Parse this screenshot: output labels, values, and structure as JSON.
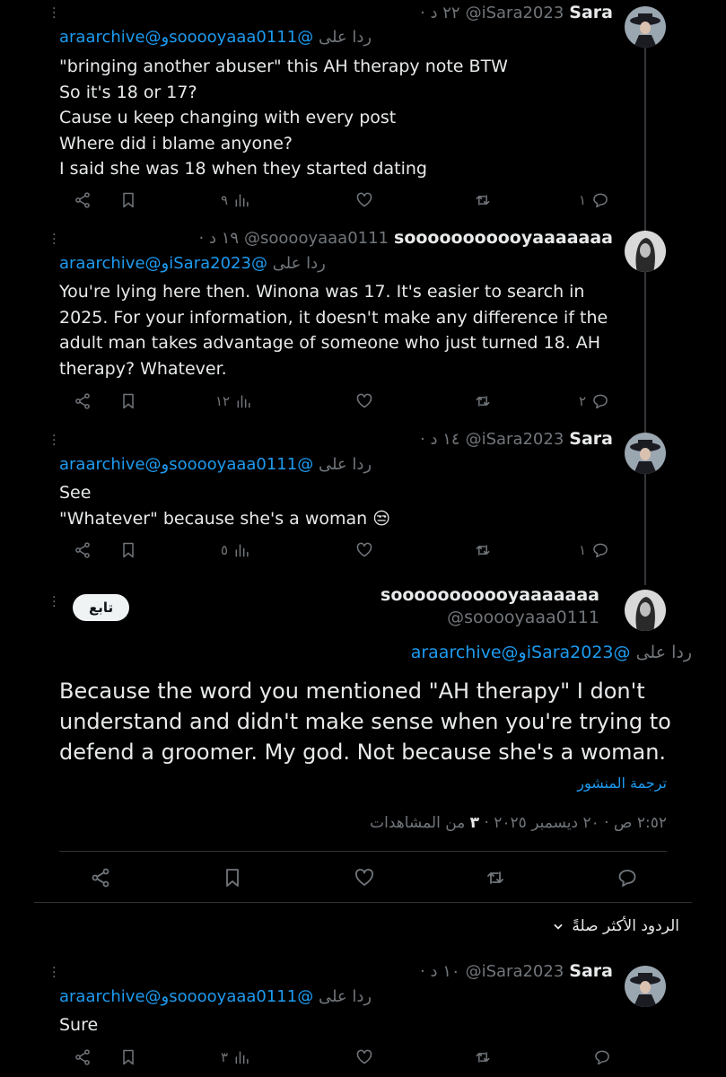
{
  "posts": [
    {
      "author_name": "Sara",
      "handle": "@iSara2023",
      "time": "· ٢٢ د",
      "reply_prefix": "ردا على",
      "reply_to_1": "@sooooyaaa0111",
      "reply_and": "و",
      "reply_to_2": "@araarchive",
      "lines": [
        "\"bringing another abuser\" this AH therapy note BTW",
        "So it's 18 or 17?",
        "Cause u keep changing with every post",
        "Where did i blame anyone?",
        "I said she was 18 when they started dating"
      ],
      "replies": "١",
      "views": "٩"
    },
    {
      "author_name": "sooooooooooyaaaaaaa",
      "handle": "@sooooyaaa0111",
      "time": "· ١٩ د",
      "reply_prefix": "ردا على",
      "reply_to_1": "@iSara2023",
      "reply_and": "و",
      "reply_to_2": "@araarchive",
      "lines": [
        "You're lying here then. Winona was 17. It's easier to search in",
        "2025. For your information, it doesn't make any difference if the",
        "adult man takes advantage of someone who just turned 18. AH",
        "therapy? Whatever."
      ],
      "replies": "٢",
      "views": "١٢"
    },
    {
      "author_name": "Sara",
      "handle": "@iSara2023",
      "time": "· ١٤ د",
      "reply_prefix": "ردا على",
      "reply_to_1": "@sooooyaaa0111",
      "reply_and": "و",
      "reply_to_2": "@araarchive",
      "lines": [
        "See",
        "\"Whatever\" because she's a woman 😒"
      ],
      "replies": "١",
      "views": "٥"
    }
  ],
  "main": {
    "author_name": "sooooooooooyaaaaaaa",
    "handle": "@sooooyaaa0111",
    "follow_label": "تابع",
    "reply_prefix": "ردا على",
    "reply_to_1": "@iSara2023",
    "reply_and": "و",
    "reply_to_2": "@araarchive",
    "lines": [
      "Because the word you mentioned \"AH therapy\" I don't",
      "understand and didn't make sense when you're trying to",
      "defend a groomer. My god. Not because she's a woman."
    ],
    "translate": "ترجمة المنشور",
    "timestamp": "٢:٥٢ ص · ٢٠ ديسمبر ٢٠٢٥ ·",
    "views_count": "٣",
    "views_label": "من المشاهدات"
  },
  "sort": {
    "label": "الردود الأكثر صلةً"
  },
  "last_post": {
    "author_name": "Sara",
    "handle": "@iSara2023",
    "time": "· ١٠ د",
    "reply_prefix": "ردا على",
    "reply_to_1": "@sooooyaaa0111",
    "reply_and": "و",
    "reply_to_2": "@araarchive",
    "lines": [
      "Sure"
    ],
    "views": "٣"
  },
  "colors": {
    "background": "#000000",
    "text": "#e7e9ea",
    "muted": "#71767b",
    "link": "#1d9bf0",
    "thread_line": "#333639"
  },
  "icons": [
    "more-icon",
    "share-icon",
    "bookmark-icon",
    "views-icon",
    "like-icon",
    "repost-icon",
    "reply-icon",
    "chevron-down-icon"
  ]
}
